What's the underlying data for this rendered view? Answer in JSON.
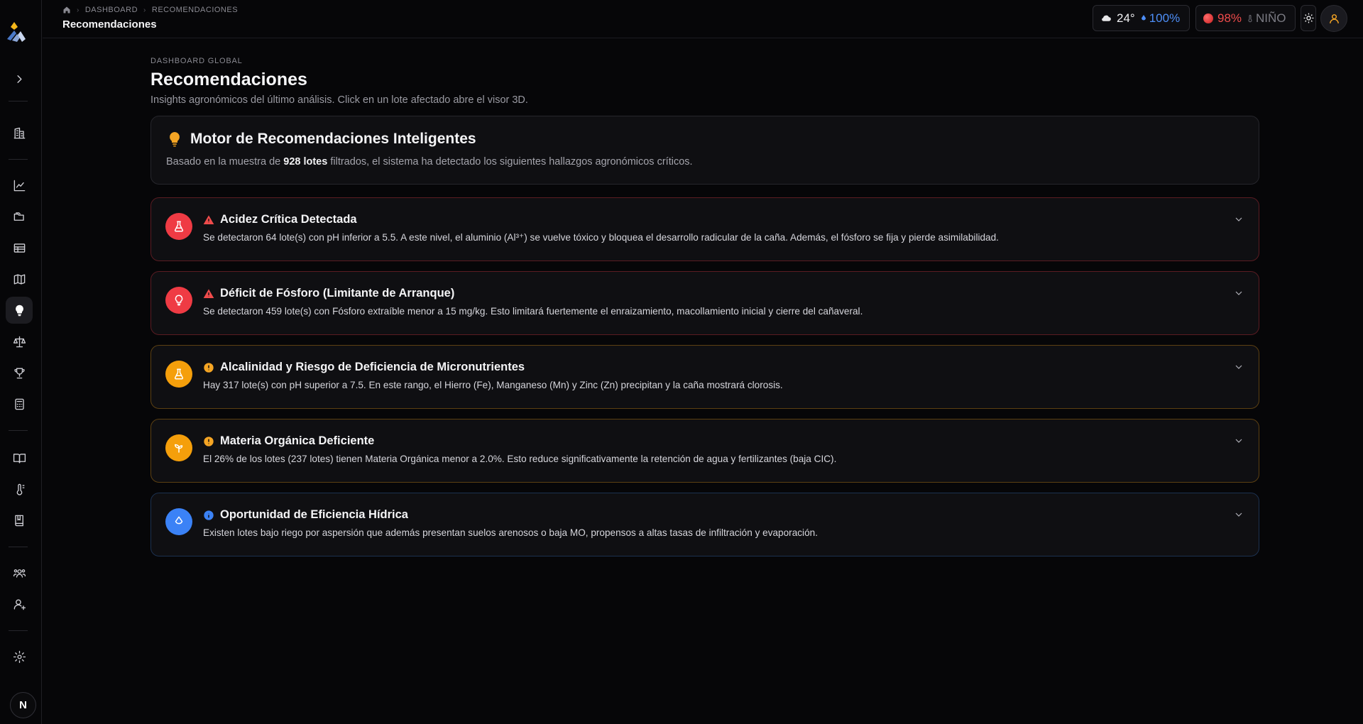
{
  "breadcrumb": {
    "items": [
      "DASHBOARD",
      "RECOMENDACIONES"
    ]
  },
  "topbar": {
    "title": "Recomendaciones",
    "weather": {
      "temp": "24°",
      "humidity": "100%"
    },
    "ndvi": {
      "value": "98%",
      "phase": "NIÑO"
    }
  },
  "sidebar": {
    "items": [
      "building-icon",
      "chart-line-icon",
      "folders-icon",
      "table-icon",
      "map-icon",
      "lightbulb-icon",
      "scale-icon",
      "trophy-icon",
      "calculator-icon",
      "book-open-icon",
      "thermometer-icon",
      "notebook-icon",
      "users-icon",
      "user-plus-icon",
      "gear-icon"
    ],
    "active": "lightbulb-icon",
    "badge": "N"
  },
  "page": {
    "eyebrow": "DASHBOARD GLOBAL",
    "title": "Recomendaciones",
    "subtitle": "Insights agronómicos del último análisis. Click en un lote afectado abre el visor 3D."
  },
  "engine": {
    "title": "Motor de Recomendaciones Inteligentes",
    "desc_prefix": "Basado en la muestra de ",
    "desc_bold": "928 lotes",
    "desc_suffix": " filtrados, el sistema ha detectado los siguientes hallazgos agronómicos críticos."
  },
  "cards": [
    {
      "title": "Acidez Crítica Detectada",
      "desc": "Se detectaron 64 lote(s) con pH inferior a 5.5. A este nivel, el aluminio (Al³⁺) se vuelve tóxico y bloquea el desarrollo radicular de la caña. Además, el fósforo se fija y pierde asimilabilidad.",
      "severity": "critical",
      "color": "#ef3b44"
    },
    {
      "title": "Déficit de Fósforo (Limitante de Arranque)",
      "desc": "Se detectaron 459 lote(s) con Fósforo extraíble menor a 15 mg/kg. Esto limitará fuertemente el enraizamiento, macollamiento inicial y cierre del cañaveral.",
      "severity": "critical",
      "color": "#ef3b44"
    },
    {
      "title": "Alcalinidad y Riesgo de Deficiencia de Micronutrientes",
      "desc": "Hay 317 lote(s) con pH superior a 7.5. En este rango, el Hierro (Fe), Manganeso (Mn) y Zinc (Zn) precipitan y la caña mostrará clorosis.",
      "severity": "warning",
      "color": "#f59f0b"
    },
    {
      "title": "Materia Orgánica Deficiente",
      "desc": "El 26% de los lotes (237 lotes) tienen Materia Orgánica menor a 2.0%. Esto reduce significativamente la retención de agua y fertilizantes (baja CIC).",
      "severity": "warning",
      "color": "#f59f0b"
    },
    {
      "title": "Oportunidad de Eficiencia Hídrica",
      "desc": "Existen lotes bajo riego por aspersión que además presentan suelos arenosos o baja MO, propensos a altas tasas de infiltración y evaporación.",
      "severity": "info",
      "color": "#3b82f6"
    }
  ]
}
